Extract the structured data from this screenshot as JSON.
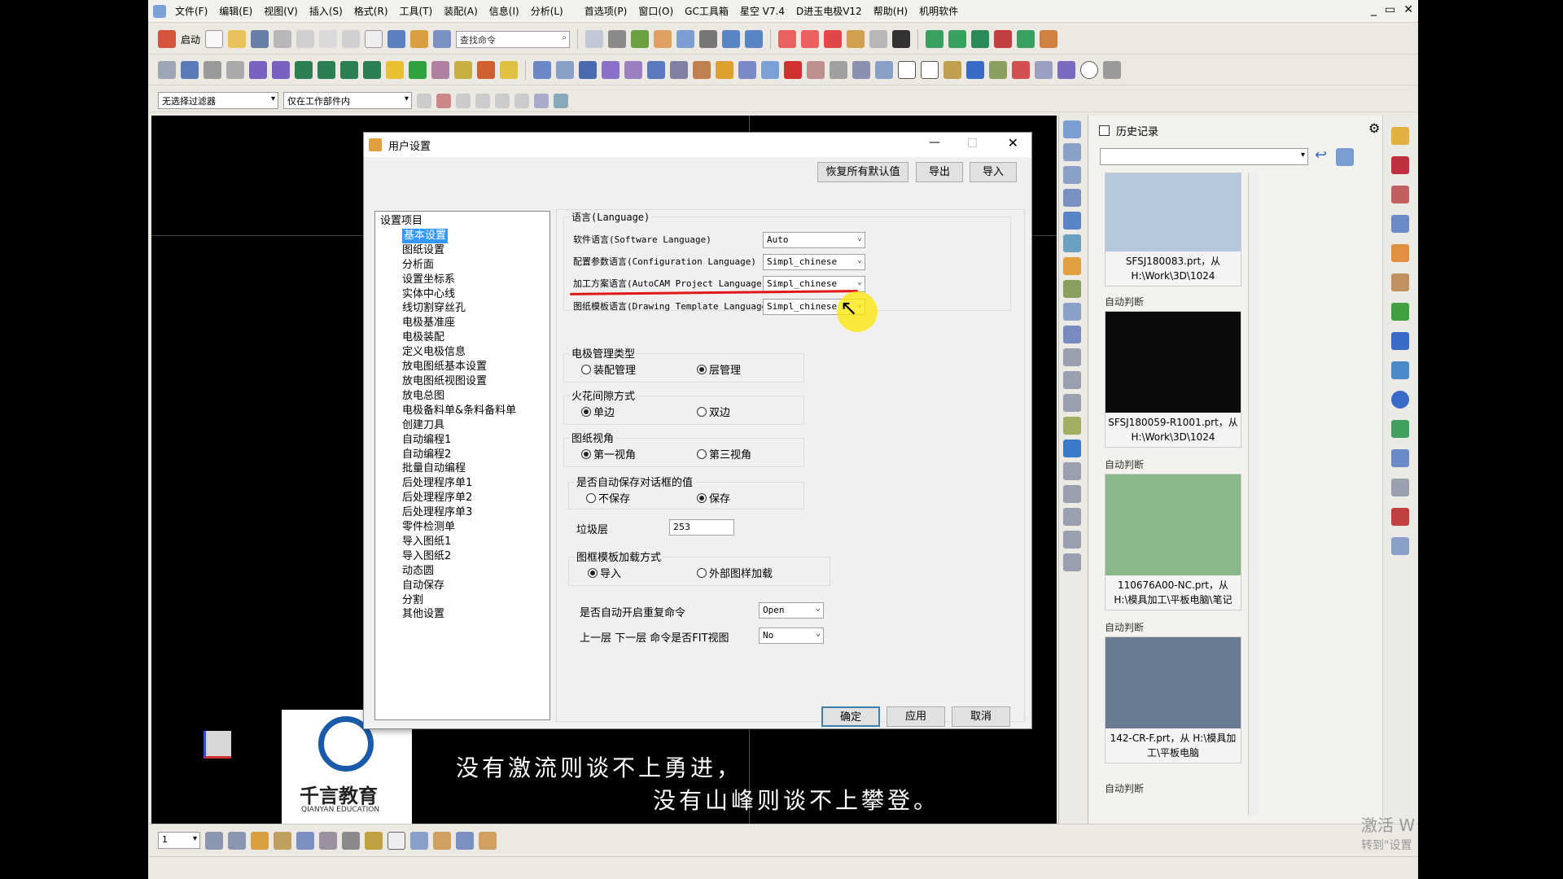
{
  "menu": [
    "文件(F)",
    "编辑(E)",
    "视图(V)",
    "插入(S)",
    "格式(R)",
    "工具(T)",
    "装配(A)",
    "信息(I)",
    "分析(L)",
    "首选项(P)",
    "窗口(O)",
    "GC工具箱",
    "星空 V7.4",
    "D进玉电极V12",
    "帮助(H)",
    "机明软件"
  ],
  "window_controls": [
    "_",
    "▭",
    "✕"
  ],
  "toolbar": {
    "start_label": "启动",
    "search_placeholder": "查找命令",
    "filter_select": "无选择过滤器",
    "scope_select": "仅在工作部件内"
  },
  "dialog": {
    "title": "用户设置",
    "btn_restore": "恢复所有默认值",
    "btn_export": "导出",
    "btn_import": "导入",
    "tree_root": "设置项目",
    "tree_items": [
      "基本设置",
      "图纸设置",
      "分析面",
      "设置坐标系",
      "实体中心线",
      "线切割穿丝孔",
      "电极基准座",
      "电极装配",
      "定义电极信息",
      "放电图纸基本设置",
      "放电图纸视图设置",
      "放电总图",
      "电极备料单&条料备料单",
      "创建刀具",
      "自动编程1",
      "自动编程2",
      "批量自动编程",
      "后处理程序单1",
      "后处理程序单2",
      "后处理程序单3",
      "零件检测单",
      "导入图纸1",
      "导入图纸2",
      "动态圆",
      "自动保存",
      "分割",
      "其他设置"
    ],
    "language_group": "语言(Language)",
    "lang_rows": [
      {
        "label": "软件语言(Software Language)",
        "value": "Auto"
      },
      {
        "label": "配置参数语言(Configuration Language)",
        "value": "Simpl_chinese"
      },
      {
        "label": "加工方案语言(AutoCAM Project Language)",
        "value": "Simpl_chinese"
      },
      {
        "label": "图纸模板语言(Drawing Template Language)",
        "value": "Simpl_chinese"
      }
    ],
    "electrode_group": "电极管理类型",
    "electrode_opts": [
      "装配管理",
      "层管理"
    ],
    "spark_group": "火花间隙方式",
    "spark_opts": [
      "单边",
      "双边"
    ],
    "view_group": "图纸视角",
    "view_opts": [
      "第一视角",
      "第三视角"
    ],
    "save_group": "是否自动保存对话框的值",
    "save_opts": [
      "不保存",
      "保存"
    ],
    "garbage_label": "垃圾层",
    "garbage_value": "253",
    "frame_group": "图框模板加载方式",
    "frame_opts": [
      "导入",
      "外部图样加载"
    ],
    "repeat_label": "是否自动开启重复命令",
    "repeat_value": "Open",
    "fit_label": "上一层 下一层 命令是否FIT视图",
    "fit_value": "No",
    "btn_ok": "确定",
    "btn_apply": "应用",
    "btn_cancel": "取消"
  },
  "history": {
    "title": "历史记录",
    "auto_label": "自动判断",
    "items": [
      {
        "caption": "SFSJ180083.prt，从 H:\\Work\\3D\\1024"
      },
      {
        "caption": "SFSJ180059-R1001.prt，从 H:\\Work\\3D\\1024"
      },
      {
        "caption": "110676A00-NC.prt，从 H:\\模具加工\\平板电脑\\笔记"
      },
      {
        "caption": "142-CR-F.prt，从 H:\\模具加工\\平板电脑"
      }
    ]
  },
  "bottom": {
    "layer_select": "1"
  },
  "brand": {
    "name": "千言教育",
    "sub": "QIANYAN EDUCATION"
  },
  "subtitles": [
    "没有激流则谈不上勇进，",
    "没有山峰则谈不上攀登。"
  ],
  "watermark": [
    "激活 W",
    "转到\"设置"
  ]
}
